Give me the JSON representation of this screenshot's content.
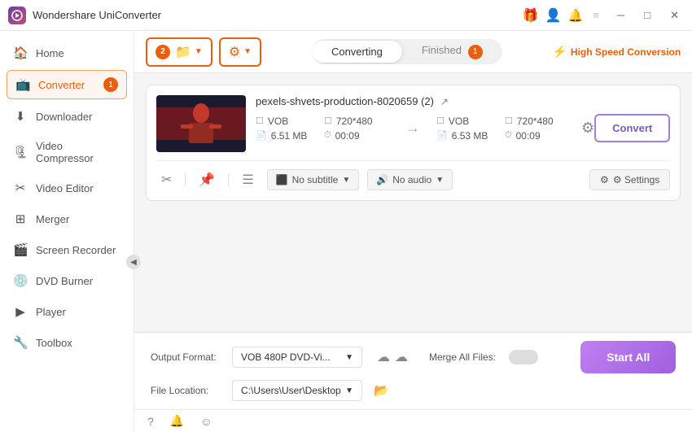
{
  "titlebar": {
    "app_name": "Wondershare UniConverter",
    "logo_text": "W"
  },
  "sidebar": {
    "items": [
      {
        "id": "home",
        "label": "Home",
        "icon": "🏠",
        "active": false
      },
      {
        "id": "converter",
        "label": "Converter",
        "icon": "📺",
        "active": true,
        "badge": "1"
      },
      {
        "id": "downloader",
        "label": "Downloader",
        "icon": "⬇",
        "active": false
      },
      {
        "id": "video-compressor",
        "label": "Video Compressor",
        "icon": "🗜",
        "active": false
      },
      {
        "id": "video-editor",
        "label": "Video Editor",
        "icon": "✂",
        "active": false
      },
      {
        "id": "merger",
        "label": "Merger",
        "icon": "⊞",
        "active": false
      },
      {
        "id": "screen-recorder",
        "label": "Screen Recorder",
        "icon": "🎬",
        "active": false
      },
      {
        "id": "dvd-burner",
        "label": "DVD Burner",
        "icon": "💿",
        "active": false
      },
      {
        "id": "player",
        "label": "Player",
        "icon": "▶",
        "active": false
      },
      {
        "id": "toolbox",
        "label": "Toolbox",
        "icon": "🔧",
        "active": false
      }
    ]
  },
  "toolbar": {
    "add_btn_label": "▶",
    "badge_num": "2",
    "converting_tab": "Converting",
    "finished_tab": "Finished",
    "finished_badge": "1",
    "high_speed_label": "High Speed Conversion"
  },
  "file": {
    "name": "pexels-shvets-production-8020659 (2)",
    "input": {
      "format": "VOB",
      "resolution": "720*480",
      "size": "6.51 MB",
      "duration": "00:09"
    },
    "output": {
      "format": "VOB",
      "resolution": "720*480",
      "size": "6.53 MB",
      "duration": "00:09"
    },
    "convert_btn": "Convert",
    "settings_btn": "⚙ Settings",
    "subtitle": "No subtitle",
    "audio": "No audio"
  },
  "bottom": {
    "output_format_label": "Output Format:",
    "output_format_value": "VOB 480P DVD-Vi...",
    "file_location_label": "File Location:",
    "file_location_value": "C:\\Users\\User\\Desktop",
    "merge_label": "Merge All Files:",
    "start_btn": "Start All"
  },
  "statusbar": {
    "icons": [
      "?",
      "🔔",
      "☺"
    ]
  }
}
